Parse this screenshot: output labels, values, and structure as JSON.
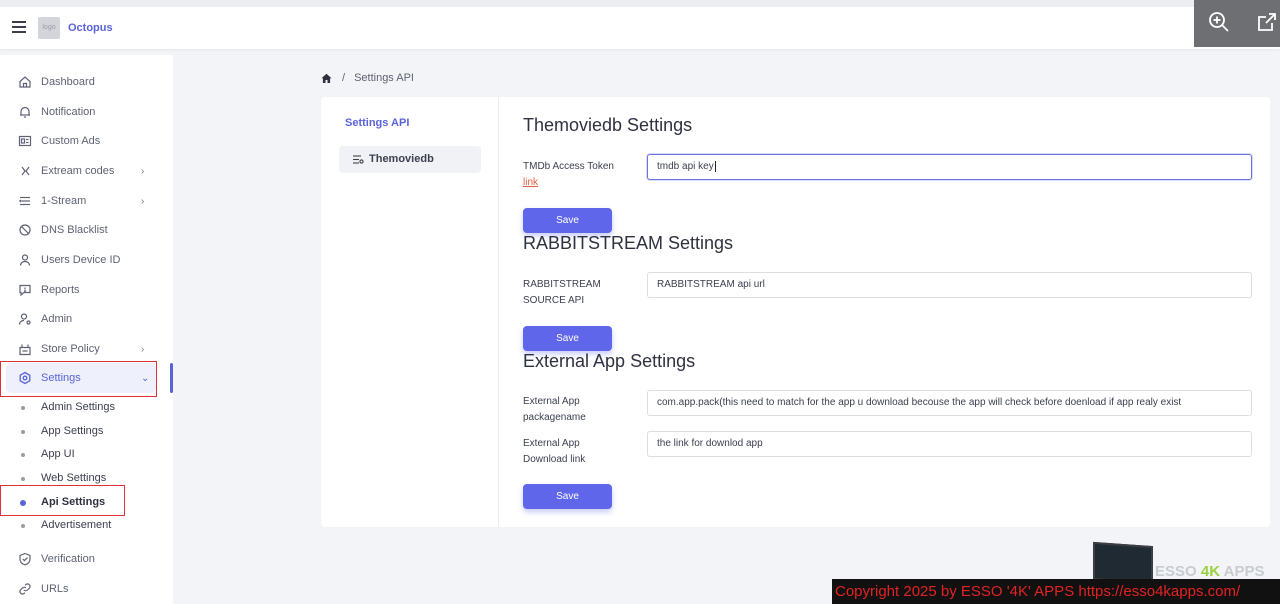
{
  "header": {
    "brand": "Octopus",
    "logo_text": "logo"
  },
  "sidebar": {
    "items": [
      {
        "label": "Dashboard",
        "icon": "home-icon"
      },
      {
        "label": "Notification",
        "icon": "bell-icon"
      },
      {
        "label": "Custom Ads",
        "icon": "ad-icon"
      },
      {
        "label": "Extream codes",
        "icon": "code-icon",
        "has_submenu": true
      },
      {
        "label": "1-Stream",
        "icon": "list-icon",
        "has_submenu": true
      },
      {
        "label": "DNS Blacklist",
        "icon": "block-icon"
      },
      {
        "label": "Users Device ID",
        "icon": "user-icon"
      },
      {
        "label": "Reports",
        "icon": "report-icon"
      },
      {
        "label": "Admin",
        "icon": "admin-icon"
      },
      {
        "label": "Store Policy",
        "icon": "store-icon",
        "has_submenu": true
      },
      {
        "label": "Settings",
        "icon": "settings-icon",
        "active": true,
        "expanded": true
      }
    ],
    "settings_sub": [
      {
        "label": "Admin Settings"
      },
      {
        "label": "App Settings"
      },
      {
        "label": "App UI"
      },
      {
        "label": "Web Settings"
      },
      {
        "label": "Api Settings",
        "current": true
      },
      {
        "label": "Advertisement"
      }
    ],
    "bottom_items": [
      {
        "label": "Verification",
        "icon": "shield-icon"
      },
      {
        "label": "URLs",
        "icon": "link-icon"
      }
    ]
  },
  "breadcrumb": {
    "current": "Settings API"
  },
  "settings_nav": {
    "title": "Settings API",
    "tab": "Themoviedb"
  },
  "sections": {
    "themoviedb": {
      "title": "Themoviedb Settings",
      "field_label": "TMDb Access Token",
      "link_text": "link",
      "value": "tmdb api key",
      "save": "Save"
    },
    "rabbitstream": {
      "title": "RABBITSTREAM Settings",
      "field_label_line1": "RABBITSTREAM",
      "field_label_line2": "SOURCE API",
      "value": "RABBITSTREAM  api url",
      "save": "Save"
    },
    "external": {
      "title": "External App Settings",
      "pkg_label_line1": "External App",
      "pkg_label_line2": "packagename",
      "pkg_value": "com.app.pack(this need to match for the app u download becouse the app will check before doenload if app realy exist",
      "dl_label_line1": "External App",
      "dl_label_line2": "Download link",
      "dl_value": "the link for downlod app",
      "save": "Save"
    }
  },
  "watermark": {
    "brand_prefix": "ESSO ",
    "brand_k": "4K",
    "brand_suffix": " APPS",
    "copyright": "Copyright 2025  by ESSO '4K' APPS https://esso4kapps.com/"
  },
  "colors": {
    "accent": "#5a63d8",
    "button": "#5f66ea",
    "highlight_box": "#e0303a"
  }
}
